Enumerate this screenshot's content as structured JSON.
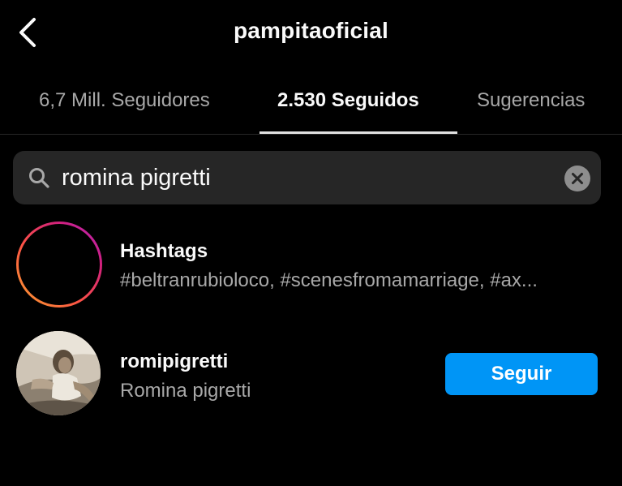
{
  "header": {
    "title": "pampitaoficial",
    "back_icon": "chevron-left-icon"
  },
  "tabs": [
    {
      "label": "6,7 Mill. Seguidores",
      "active": false
    },
    {
      "label": "2.530 Seguidos",
      "active": true
    },
    {
      "label": "Sugerencias",
      "active": false
    }
  ],
  "search": {
    "value": "romina pigretti",
    "icon": "search-icon",
    "clear_icon": "clear-icon"
  },
  "results": [
    {
      "type": "hashtags",
      "title": "Hashtags",
      "subtitle": "#beltranrubioloco, #scenesfromamarriage, #ax...",
      "icon": "hashtag-icon"
    },
    {
      "type": "user",
      "username": "romipigretti",
      "full_name": "Romina pigretti",
      "action_label": "Seguir"
    }
  ],
  "colors": {
    "background": "#000000",
    "primary_text": "#fafafa",
    "secondary_text": "#a8a8a8",
    "search_bg": "#262626",
    "follow_button": "#0095f6"
  }
}
